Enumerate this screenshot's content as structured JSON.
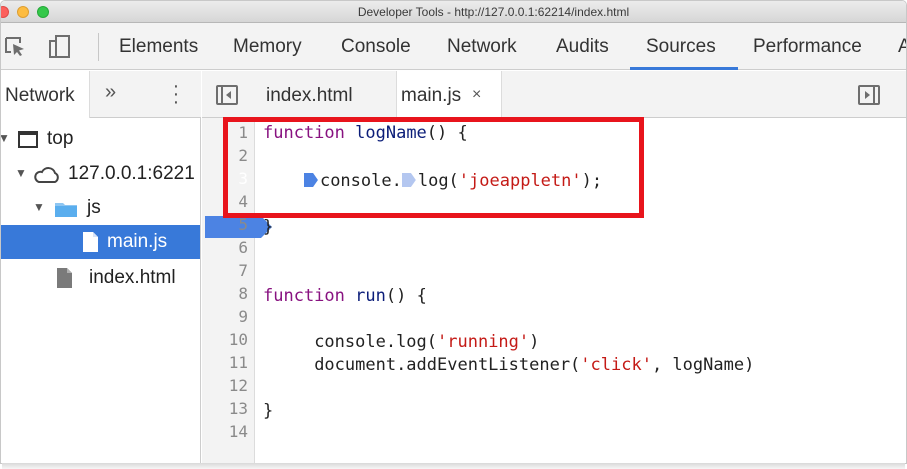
{
  "window": {
    "title": "Developer Tools - http://127.0.0.1:62214/index.html"
  },
  "main_tabs": [
    "Elements",
    "Memory",
    "Console",
    "Network",
    "Audits",
    "Sources",
    "Performance",
    "A"
  ],
  "active_main_tab": "Sources",
  "navigator": {
    "tab": "Network",
    "more_label": "»",
    "menu_label": "⋮",
    "tree": [
      {
        "label": "top",
        "icon": "frame-icon",
        "indent": 0
      },
      {
        "label": "127.0.0.1:6221",
        "icon": "cloud-icon",
        "indent": 1
      },
      {
        "label": "js",
        "icon": "folder-icon",
        "indent": 2
      },
      {
        "label": "main.js",
        "icon": "file-icon",
        "indent": 3,
        "selected": true
      },
      {
        "label": "index.html",
        "icon": "file-icon",
        "indent": 2
      }
    ]
  },
  "editor": {
    "tabs": [
      {
        "label": "index.html",
        "active": false
      },
      {
        "label": "main.js",
        "active": true,
        "close": "×"
      }
    ],
    "lines": [
      "1",
      "2",
      "3",
      "4",
      "5",
      "6",
      "7",
      "8",
      "9",
      "10",
      "11",
      "12",
      "13",
      "14"
    ],
    "breakpoint_line": "3",
    "code": {
      "l1_kw": "function",
      "l1_name": "logName",
      "l1_rest": "() {",
      "l3_obj": "console.",
      "l3_call": "log(",
      "l3_str": "'joeappletn'",
      "l3_end": ");",
      "l5": "}",
      "l8_kw": "function",
      "l8_name": "run",
      "l8_rest": "() {",
      "l10_pre": "console.log(",
      "l10_str": "'running'",
      "l10_end": ")",
      "l11_pre": "document.addEventListener(",
      "l11_str": "'click'",
      "l11_end": ", logName)",
      "l13": "}"
    }
  },
  "colors": {
    "accent": "#3879d9",
    "breakpoint": "#4c83e3",
    "highlight": "#e8141c"
  }
}
